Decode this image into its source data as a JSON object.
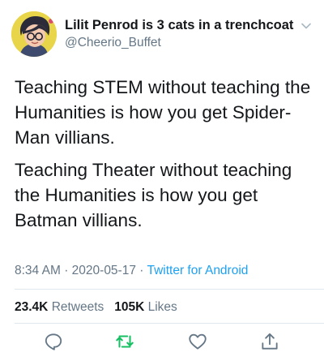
{
  "user": {
    "display_name": "Lilit Penrod is 3 cats in a trenchcoat",
    "handle": "@Cheerio_Buffet",
    "avatar": "avatar-illustration"
  },
  "tweet": {
    "paragraphs": [
      "Teaching STEM without teaching the\nHumanities is how you get Spider-\nMan villians.",
      "Teaching Theater without teaching\nthe Humanities is how you get\nBatman villians."
    ]
  },
  "meta": {
    "time": "8:34 AM",
    "date": "2020-05-17",
    "separator": "·",
    "source": "Twitter for Android"
  },
  "stats": {
    "retweets_count": "23.4K",
    "retweets_label": "Retweets",
    "likes_count": "105K",
    "likes_label": "Likes"
  },
  "actions": [
    "reply-icon",
    "retweet-icon",
    "like-icon",
    "share-icon"
  ],
  "colors": {
    "text": "#14171a",
    "secondary": "#657786",
    "link": "#1da1f2",
    "retweet_green": "#17bf63",
    "divider": "#e1e8ed"
  }
}
